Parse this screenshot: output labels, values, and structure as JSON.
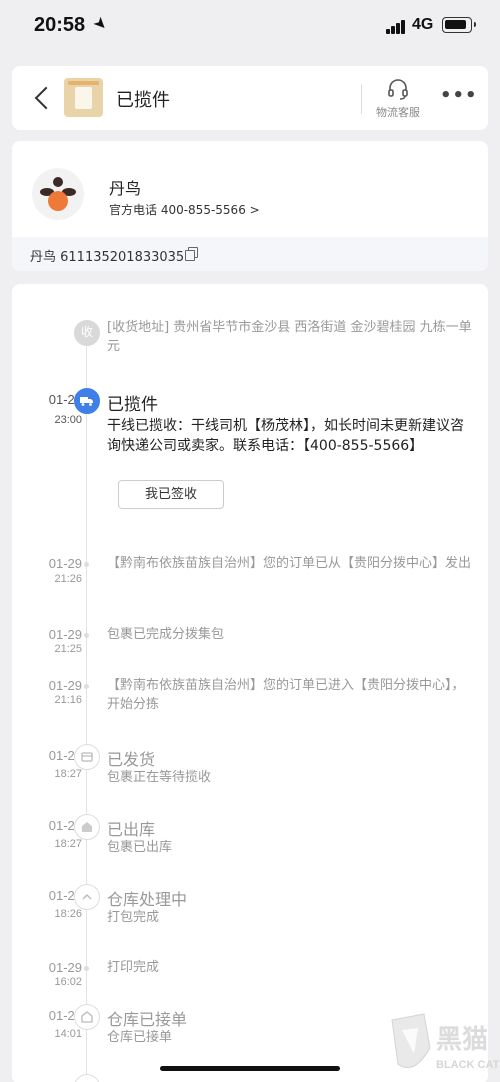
{
  "status_bar": {
    "time": "20:58",
    "network": "4G"
  },
  "header": {
    "title": "已揽件",
    "service_label": "物流客服",
    "more_label": "•••"
  },
  "carrier": {
    "name": "丹鸟",
    "phone_text": "官方电话 400-855-5566 >",
    "tracking_text": "丹鸟 611135201833035"
  },
  "address_event": {
    "node_label": "收",
    "text": "[收货地址] 贵州省毕节市金沙县  西洛街道   金沙碧桂园 九栋一单元"
  },
  "events": [
    {
      "date": "01-29",
      "time": "23:00",
      "title": "已揽件",
      "detail": "干线已揽收：干线司机【杨茂林】，如长时间未更新建议咨询快递公司或卖家。联系电话：【400-855-5566】",
      "button_label": "我已签收"
    },
    {
      "date": "01-29",
      "time": "21:26",
      "title": "",
      "detail": "【黔南布依族苗族自治州】您的订单已从【贵阳分拨中心】发出"
    },
    {
      "date": "01-29",
      "time": "21:25",
      "title": "",
      "detail": "包裹已完成分拨集包"
    },
    {
      "date": "01-29",
      "time": "21:16",
      "title": "",
      "detail": "【黔南布依族苗族自治州】您的订单已进入【贵阳分拨中心】，开始分拣"
    },
    {
      "date": "01-29",
      "time": "18:27",
      "title": "已发货",
      "detail": "包裹正在等待揽收"
    },
    {
      "date": "01-29",
      "time": "18:27",
      "title": "已出库",
      "detail": "包裹已出库"
    },
    {
      "date": "01-29",
      "time": "18:26",
      "title": "仓库处理中",
      "detail": "打包完成"
    },
    {
      "date": "01-29",
      "time": "16:02",
      "title": "",
      "detail": "打印完成"
    },
    {
      "date": "01-28",
      "time": "14:01",
      "title": "仓库已接单",
      "detail": "仓库已接单"
    }
  ],
  "watermark": {
    "text": "黑猫",
    "sub": "BLACK CAT"
  },
  "colors": {
    "accent": "#3f7fe8",
    "logo_orange": "#ee7a3a",
    "logo_dark": "#3b2a25"
  }
}
